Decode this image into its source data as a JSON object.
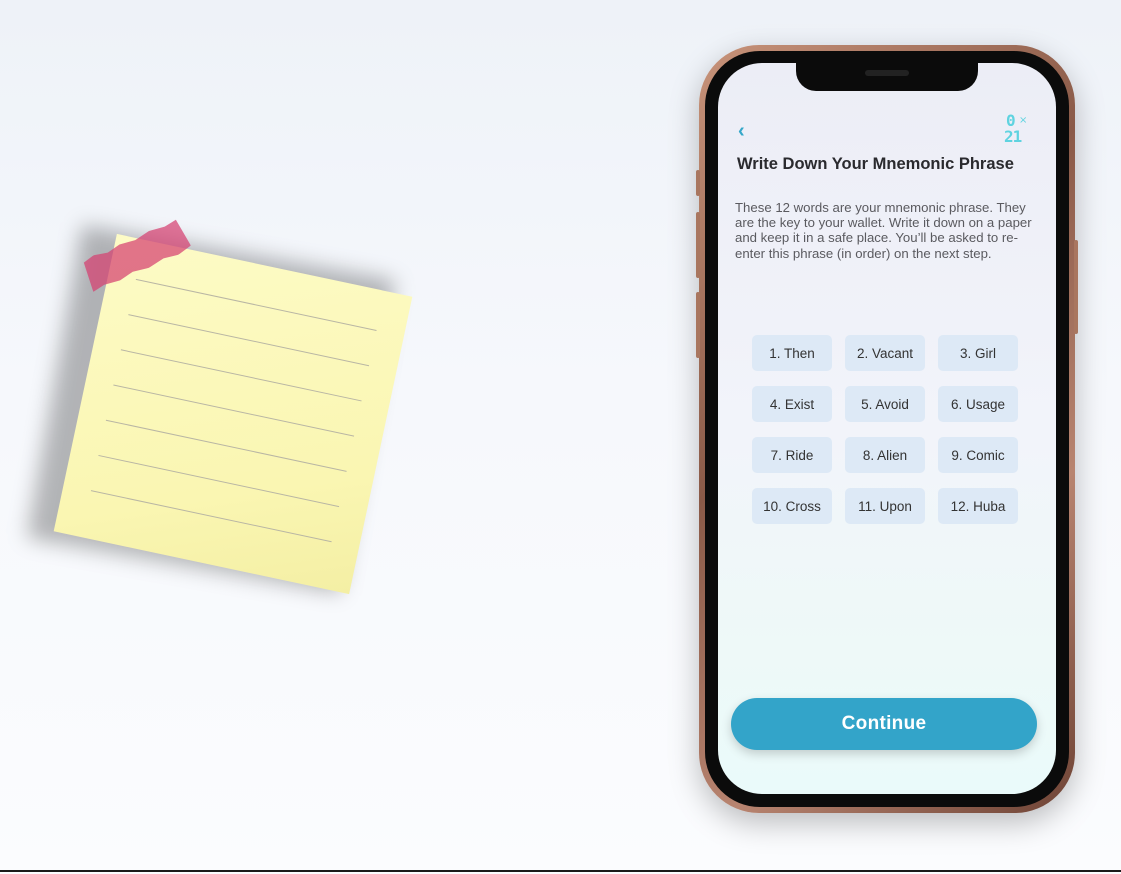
{
  "screen": {
    "back_icon": "‹",
    "logo": {
      "top": "0",
      "x": "×",
      "bottom": "21"
    },
    "title": "Write Down Your Mnemonic Phrase",
    "description": "These 12 words are your mnemonic phrase. They are the key to your wallet. Write it down on a paper and keep it in a safe place. You’ll be asked to re-enter this phrase (in order) on the next step.",
    "words": [
      "1. Then",
      "2. Vacant",
      "3. Girl",
      "4. Exist",
      "5. Avoid",
      "6. Usage",
      "7. Ride",
      "8. Alien",
      "9. Comic",
      "10. Cross",
      "11. Upon",
      "12. Huba"
    ],
    "continue_label": "Continue"
  },
  "colors": {
    "accent": "#33a4c9",
    "logo": "#5fd3e0",
    "chip_bg": "#dde9f6",
    "note": "#fbf7b6",
    "tape": "#d64070"
  }
}
